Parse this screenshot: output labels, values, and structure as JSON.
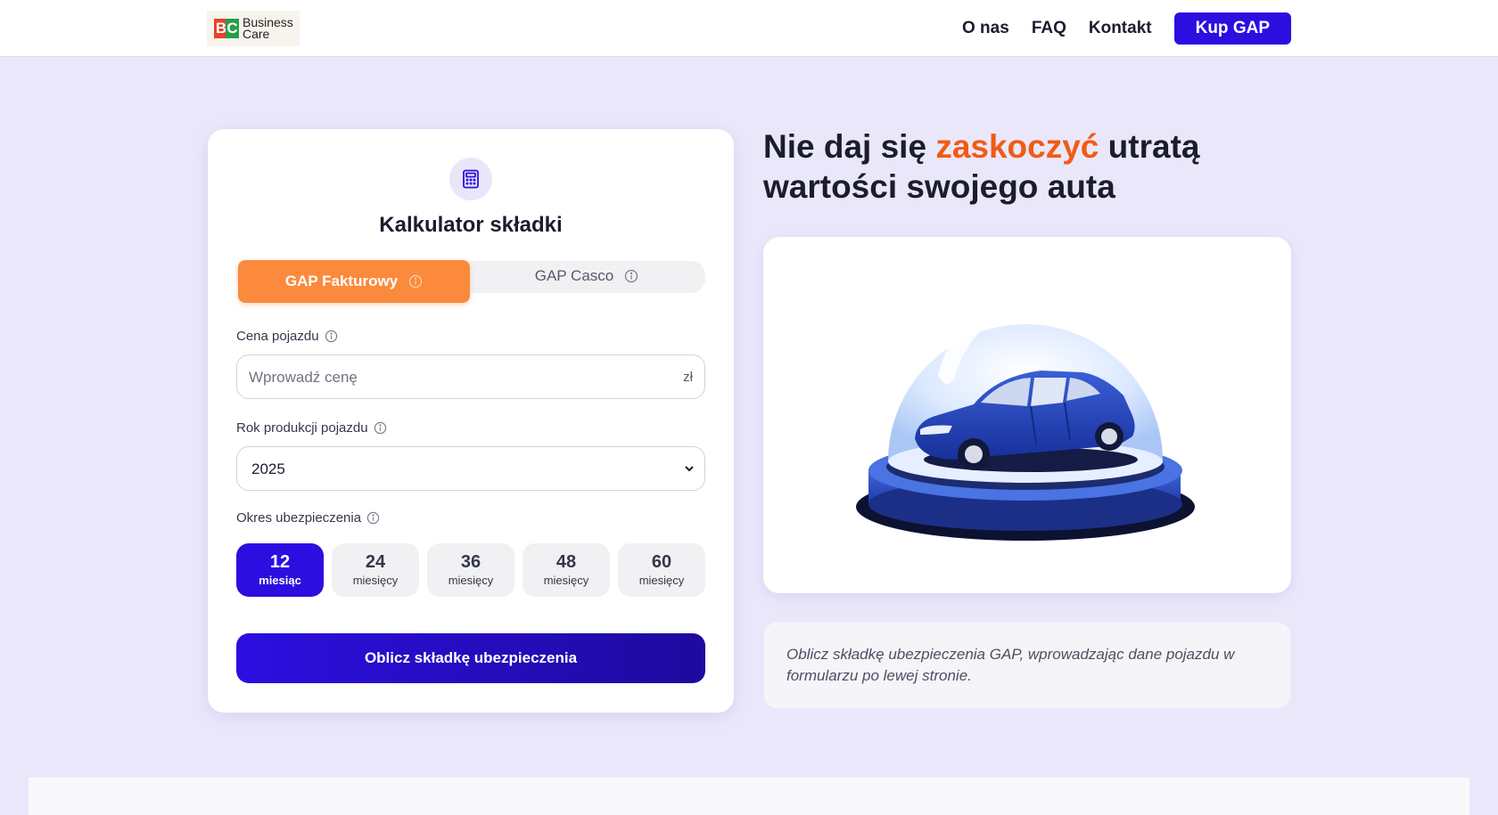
{
  "header": {
    "logo_letters": "BC",
    "logo_text": "Business\nCare",
    "nav": [
      "O nas",
      "FAQ",
      "Kontakt"
    ],
    "cta_label": "Kup GAP"
  },
  "calculator": {
    "icon": "calculator-icon",
    "title": "Kalkulator składki",
    "tabs": [
      {
        "label": "GAP Fakturowy",
        "active": true
      },
      {
        "label": "GAP Casco",
        "active": false
      }
    ],
    "price": {
      "label": "Cena pojazdu",
      "placeholder": "Wprowadź cenę",
      "suffix": "zł"
    },
    "year": {
      "label": "Rok produkcji pojazdu",
      "value": "2025"
    },
    "period": {
      "label": "Okres ubezpieczenia",
      "options": [
        {
          "num": "12",
          "unit": "miesiąc",
          "active": true
        },
        {
          "num": "24",
          "unit": "miesięcy",
          "active": false
        },
        {
          "num": "36",
          "unit": "miesięcy",
          "active": false
        },
        {
          "num": "48",
          "unit": "miesięcy",
          "active": false
        },
        {
          "num": "60",
          "unit": "miesięcy",
          "active": false
        }
      ]
    },
    "submit_label": "Oblicz składkę ubezpieczenia"
  },
  "hero": {
    "headline_part1": "Nie daj się ",
    "headline_accent": "zaskoczyć",
    "headline_part2": " utratą wartości swojego auta",
    "image": "car-in-glass-dome-illustration",
    "info": "Oblicz składkę ubezpieczenia GAP, wprowadzając dane pojazdu w formularzu po lewej stronie."
  },
  "colors": {
    "brand": "#2c0fe0",
    "accent_orange": "#fb8a3c",
    "headline_accent": "#f25a14",
    "page_bg": "#ebe7fb"
  }
}
